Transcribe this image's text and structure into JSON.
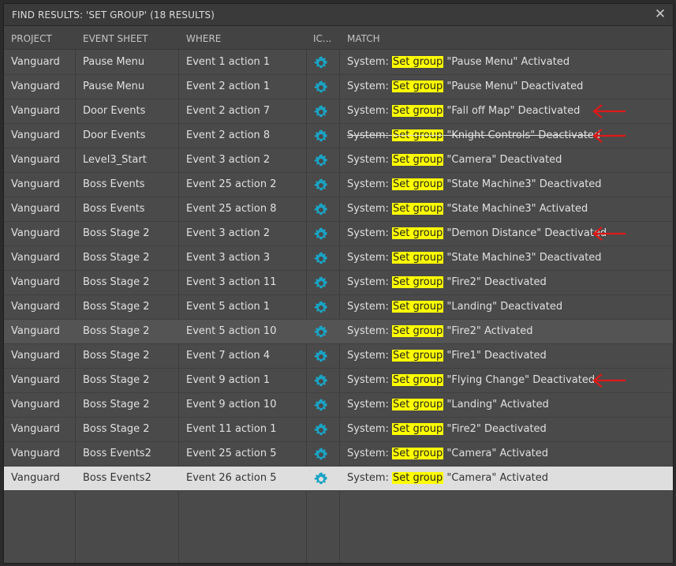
{
  "dialog": {
    "title": "FIND RESULTS: 'SET GROUP' (18 RESULTS)",
    "close_glyph": "✕"
  },
  "columns": {
    "project": "PROJECT",
    "event_sheet": "EVENT SHEET",
    "where": "WHERE",
    "icon": "IC...",
    "match": "MATCH"
  },
  "match_prefix": "System:",
  "match_highlight": "Set group",
  "icon_name": "gear-icon",
  "colors": {
    "gear_icon": "#1aa3c4",
    "highlight": "#ffff00",
    "arrow": "#e01818",
    "selected_row": "#dedede"
  },
  "rows": [
    {
      "project": "Vanguard",
      "sheet": "Pause Menu",
      "where": "Event 1 action 1",
      "match_rest": "\"Pause Menu\" Activated",
      "arrow": false,
      "strike": false
    },
    {
      "project": "Vanguard",
      "sheet": "Pause Menu",
      "where": "Event 2 action 1",
      "match_rest": "\"Pause Menu\" Deactivated",
      "arrow": false,
      "strike": false
    },
    {
      "project": "Vanguard",
      "sheet": "Door Events",
      "where": "Event 2 action 7",
      "match_rest": "\"Fall off Map\" Deactivated",
      "arrow": true,
      "strike": false
    },
    {
      "project": "Vanguard",
      "sheet": "Door Events",
      "where": "Event 2 action 8",
      "match_rest": "\"Knight Controls\" Deactivated",
      "arrow": true,
      "strike": true
    },
    {
      "project": "Vanguard",
      "sheet": "Level3_Start",
      "where": "Event 3 action 2",
      "match_rest": "\"Camera\" Deactivated",
      "arrow": false,
      "strike": false
    },
    {
      "project": "Vanguard",
      "sheet": "Boss Events",
      "where": "Event 25 action 2",
      "match_rest": "\"State Machine3\" Deactivated",
      "arrow": false,
      "strike": false
    },
    {
      "project": "Vanguard",
      "sheet": "Boss Events",
      "where": "Event 25 action 8",
      "match_rest": "\"State Machine3\" Activated",
      "arrow": false,
      "strike": false
    },
    {
      "project": "Vanguard",
      "sheet": "Boss Stage 2",
      "where": "Event 3 action 2",
      "match_rest": "\"Demon Distance\" Deactivated",
      "arrow": true,
      "strike": false
    },
    {
      "project": "Vanguard",
      "sheet": "Boss Stage 2",
      "where": "Event 3 action 3",
      "match_rest": "\"State Machine3\" Deactivated",
      "arrow": false,
      "strike": false
    },
    {
      "project": "Vanguard",
      "sheet": "Boss Stage 2",
      "where": "Event 3 action 11",
      "match_rest": "\"Fire2\" Deactivated",
      "arrow": false,
      "strike": false
    },
    {
      "project": "Vanguard",
      "sheet": "Boss Stage 2",
      "where": "Event 5 action 1",
      "match_rest": "\"Landing\" Deactivated",
      "arrow": false,
      "strike": false
    },
    {
      "project": "Vanguard",
      "sheet": "Boss Stage 2",
      "where": "Event 5 action 10",
      "match_rest": "\"Fire2\" Activated",
      "arrow": false,
      "strike": false,
      "hover": true
    },
    {
      "project": "Vanguard",
      "sheet": "Boss Stage 2",
      "where": "Event 7 action 4",
      "match_rest": "\"Fire1\" Deactivated",
      "arrow": false,
      "strike": false
    },
    {
      "project": "Vanguard",
      "sheet": "Boss Stage 2",
      "where": "Event 9 action 1",
      "match_rest": "\"Flying Change\" Deactivated",
      "arrow": true,
      "strike": false
    },
    {
      "project": "Vanguard",
      "sheet": "Boss Stage 2",
      "where": "Event 9 action 10",
      "match_rest": "\"Landing\" Activated",
      "arrow": false,
      "strike": false
    },
    {
      "project": "Vanguard",
      "sheet": "Boss Stage 2",
      "where": "Event 11 action 1",
      "match_rest": "\"Fire2\" Deactivated",
      "arrow": false,
      "strike": false
    },
    {
      "project": "Vanguard",
      "sheet": "Boss Events2",
      "where": "Event 25 action 5",
      "match_rest": "\"Camera\" Activated",
      "arrow": false,
      "strike": false
    },
    {
      "project": "Vanguard",
      "sheet": "Boss Events2",
      "where": "Event 26 action 5",
      "match_rest": "\"Camera\" Activated",
      "arrow": false,
      "strike": false,
      "selected": true
    }
  ]
}
